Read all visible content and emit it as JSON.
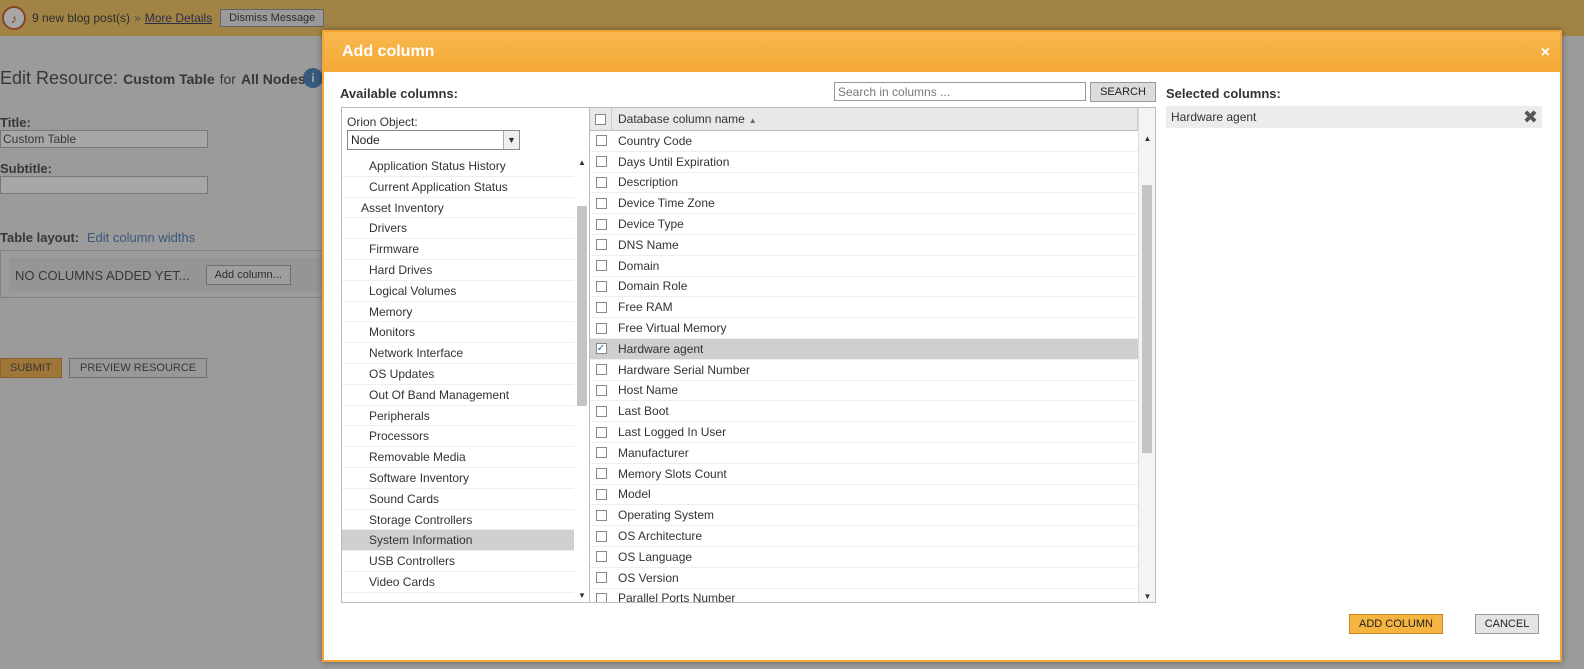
{
  "notify": {
    "logo": "♪",
    "text": "9 new blog post(s)",
    "separator": "»",
    "link": "More Details",
    "dismiss": "Dismiss Message"
  },
  "page": {
    "edit_prefix": "Edit Resource:",
    "resource_name": "Custom Table",
    "for_text": "for",
    "target": "All Nodes",
    "title_label": "Title:",
    "title_value": "Custom Table",
    "subtitle_label": "Subtitle:",
    "subtitle_value": "",
    "table_layout_label": "Table layout:",
    "edit_widths_link": "Edit column widths",
    "no_columns_text": "NO COLUMNS ADDED YET...",
    "add_column_small": "Add column...",
    "submit": "SUBMIT",
    "preview": "PREVIEW RESOURCE"
  },
  "dialog": {
    "title": "Add column",
    "close": "×",
    "available_label": "Available columns:",
    "search_placeholder": "Search in columns ...",
    "search_button": "SEARCH",
    "orion_label": "Orion Object:",
    "orion_value": "Node",
    "tree_items": [
      {
        "label": "Application Status History",
        "group": false,
        "selected": false
      },
      {
        "label": "Current Application Status",
        "group": false,
        "selected": false
      },
      {
        "label": "Asset Inventory",
        "group": true,
        "selected": false
      },
      {
        "label": "Drivers",
        "group": false,
        "selected": false
      },
      {
        "label": "Firmware",
        "group": false,
        "selected": false
      },
      {
        "label": "Hard Drives",
        "group": false,
        "selected": false
      },
      {
        "label": "Logical Volumes",
        "group": false,
        "selected": false
      },
      {
        "label": "Memory",
        "group": false,
        "selected": false
      },
      {
        "label": "Monitors",
        "group": false,
        "selected": false
      },
      {
        "label": "Network Interface",
        "group": false,
        "selected": false
      },
      {
        "label": "OS Updates",
        "group": false,
        "selected": false
      },
      {
        "label": "Out Of Band Management",
        "group": false,
        "selected": false
      },
      {
        "label": "Peripherals",
        "group": false,
        "selected": false
      },
      {
        "label": "Processors",
        "group": false,
        "selected": false
      },
      {
        "label": "Removable Media",
        "group": false,
        "selected": false
      },
      {
        "label": "Software Inventory",
        "group": false,
        "selected": false
      },
      {
        "label": "Sound Cards",
        "group": false,
        "selected": false
      },
      {
        "label": "Storage Controllers",
        "group": false,
        "selected": false
      },
      {
        "label": "System Information",
        "group": false,
        "selected": true
      },
      {
        "label": "USB Controllers",
        "group": false,
        "selected": false
      },
      {
        "label": "Video Cards",
        "group": false,
        "selected": false
      }
    ],
    "column_header": "Database column name",
    "sort_glyph": "▲",
    "columns": [
      {
        "name": "Country Code",
        "checked": false
      },
      {
        "name": "Days Until Expiration",
        "checked": false
      },
      {
        "name": "Description",
        "checked": false
      },
      {
        "name": "Device Time Zone",
        "checked": false
      },
      {
        "name": "Device Type",
        "checked": false
      },
      {
        "name": "DNS Name",
        "checked": false
      },
      {
        "name": "Domain",
        "checked": false
      },
      {
        "name": "Domain Role",
        "checked": false
      },
      {
        "name": "Free RAM",
        "checked": false
      },
      {
        "name": "Free Virtual Memory",
        "checked": false
      },
      {
        "name": "Hardware agent",
        "checked": true
      },
      {
        "name": "Hardware Serial Number",
        "checked": false
      },
      {
        "name": "Host Name",
        "checked": false
      },
      {
        "name": "Last Boot",
        "checked": false
      },
      {
        "name": "Last Logged In User",
        "checked": false
      },
      {
        "name": "Manufacturer",
        "checked": false
      },
      {
        "name": "Memory Slots Count",
        "checked": false
      },
      {
        "name": "Model",
        "checked": false
      },
      {
        "name": "Operating System",
        "checked": false
      },
      {
        "name": "OS Architecture",
        "checked": false
      },
      {
        "name": "OS Language",
        "checked": false
      },
      {
        "name": "OS Version",
        "checked": false
      },
      {
        "name": "Parallel Ports Number",
        "checked": false
      }
    ],
    "selected_label": "Selected columns:",
    "selected_columns": [
      "Hardware agent"
    ],
    "remove_glyph": "✖",
    "add_column_button": "ADD COLUMN",
    "cancel_button": "CANCEL"
  },
  "colors": {
    "accent": "#f5a938",
    "notify_bar": "#f5c04d",
    "link": "#3a6fb0",
    "selected_row": "#cfcfcf"
  },
  "icons": {
    "close": "close-icon",
    "info": "info-icon",
    "sort": "sort-ascending-icon",
    "remove": "remove-icon",
    "dropdown": "chevron-down-icon"
  }
}
